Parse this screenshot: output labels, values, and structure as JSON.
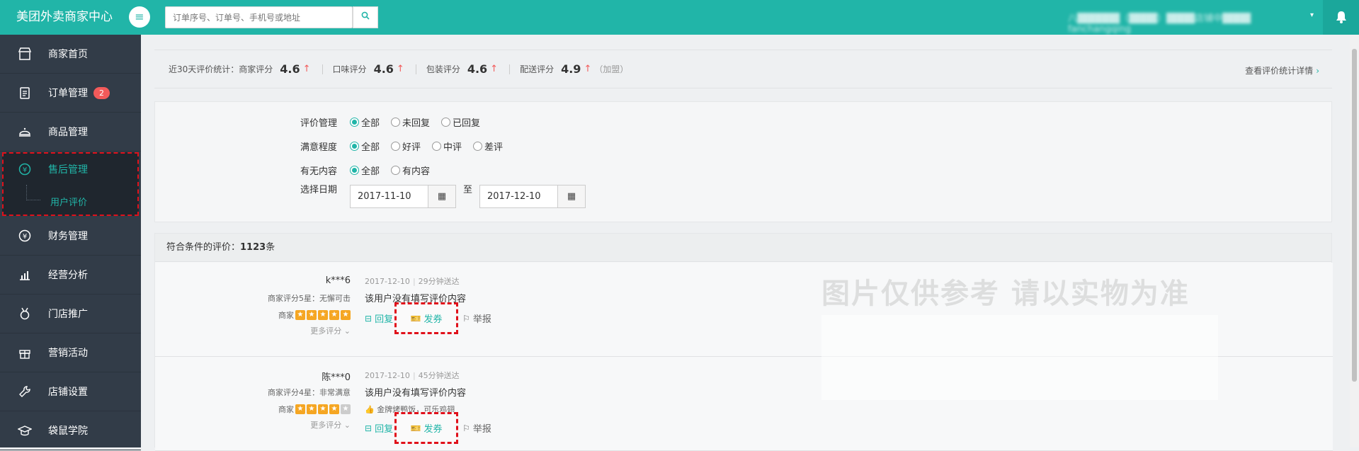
{
  "header": {
    "app_title": "美团外卖商家中心",
    "menu_icon": "hamburger-icon",
    "search_placeholder": "订单序号、订单号、手机号或地址",
    "user_text": "八██████（████）████店铺中████ fanchangqing",
    "bell_icon": "bell-icon"
  },
  "sidebar": {
    "items": [
      {
        "label": "商家首页",
        "icon": "store-icon"
      },
      {
        "label": "订单管理",
        "icon": "clipboard-icon",
        "badge": "2"
      },
      {
        "label": "商品管理",
        "icon": "dish-icon"
      },
      {
        "label": "售后管理",
        "icon": "yuan-refresh-icon"
      },
      {
        "label": "财务管理",
        "icon": "yuan-icon"
      },
      {
        "label": "经营分析",
        "icon": "chart-icon"
      },
      {
        "label": "门店推广",
        "icon": "medal-icon"
      },
      {
        "label": "营销活动",
        "icon": "gift-icon"
      },
      {
        "label": "店铺设置",
        "icon": "wrench-icon"
      },
      {
        "label": "袋鼠学院",
        "icon": "graduation-cap-icon"
      }
    ],
    "sub_item": "用户评价"
  },
  "stats": {
    "prefix": "近30天评价统计：",
    "merchant_label": "商家评分",
    "merchant_value": "4.6",
    "taste_label": "口味评分",
    "taste_value": "4.6",
    "pack_label": "包装评分",
    "pack_value": "4.6",
    "delivery_label": "配送评分",
    "delivery_value": "4.9",
    "delivery_note": "（加盟）",
    "detail_link": "查看评价统计详情"
  },
  "filters": {
    "manage_label": "评价管理",
    "manage_options": [
      "全部",
      "未回复",
      "已回复"
    ],
    "satisfaction_label": "满意程度",
    "satisfaction_options": [
      "全部",
      "好评",
      "中评",
      "差评"
    ],
    "content_label": "有无内容",
    "content_options": [
      "全部",
      "有内容"
    ],
    "date_label": "选择日期",
    "date_from": "2017-11-10",
    "date_to_label": "至",
    "date_to": "2017-12-10"
  },
  "results": {
    "label": "符合条件的评价：",
    "count": "1123",
    "unit": "条"
  },
  "reviews": [
    {
      "user": "k***6",
      "score_text": "商家评分5星：无懈可击",
      "stars_label": "商家",
      "stars": 5,
      "more": "更多评分",
      "date": "2017-12-10",
      "delivery": "29分钟送达",
      "content": "该用户没有填写评价内容",
      "tags": "",
      "reply": "回复",
      "coupon": "发券",
      "report": "举报"
    },
    {
      "user": "陈***0",
      "score_text": "商家评分4星：非常满意",
      "stars_label": "商家",
      "stars": 4,
      "more": "更多评分",
      "date": "2017-12-10",
      "delivery": "45分钟送达",
      "content": "该用户没有填写评价内容",
      "tags": "金牌烤鸭饭，可乐鸡翅",
      "reply": "回复",
      "coupon": "发券",
      "report": "举报"
    }
  ],
  "watermark": "图片仅供参考 请以实物为准",
  "colors": {
    "brand": "#21b5a8",
    "sidebar": "#323c48",
    "highlight": "#e0101a",
    "star": "#f5a623",
    "up_arrow": "#f25a5a"
  }
}
